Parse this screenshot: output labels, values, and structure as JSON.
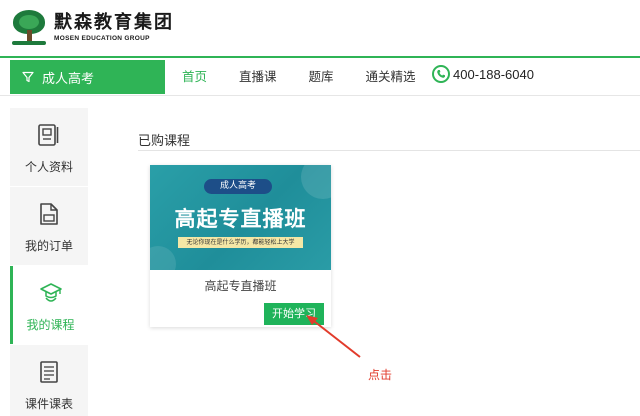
{
  "brand": {
    "name_cn": "默森教育集团",
    "name_en": "MOSEN EDUCATION GROUP"
  },
  "nav": {
    "category": "成人高考",
    "links": [
      "首页",
      "直播课",
      "题库",
      "通关精选"
    ],
    "active_index": 0,
    "phone": "400-188-6040"
  },
  "sidebar": {
    "items": [
      {
        "label": "个人资料",
        "icon": "profile-icon"
      },
      {
        "label": "我的订单",
        "icon": "order-icon"
      },
      {
        "label": "我的课程",
        "icon": "course-icon",
        "active": true
      },
      {
        "label": "课件课表",
        "icon": "schedule-icon"
      }
    ]
  },
  "main": {
    "section_title": "已购课程",
    "course": {
      "banner_tag": "成人高考",
      "banner_title": "高起专直播班",
      "banner_subtitle": "无论你现在是什么学历，都能轻松上大学",
      "name": "高起专直播班",
      "button": "开始学习"
    }
  },
  "annotation": {
    "label": "点击"
  },
  "colors": {
    "accent": "#2fb456",
    "banner": "#2a9fa8",
    "annotation": "#e23b2b"
  }
}
